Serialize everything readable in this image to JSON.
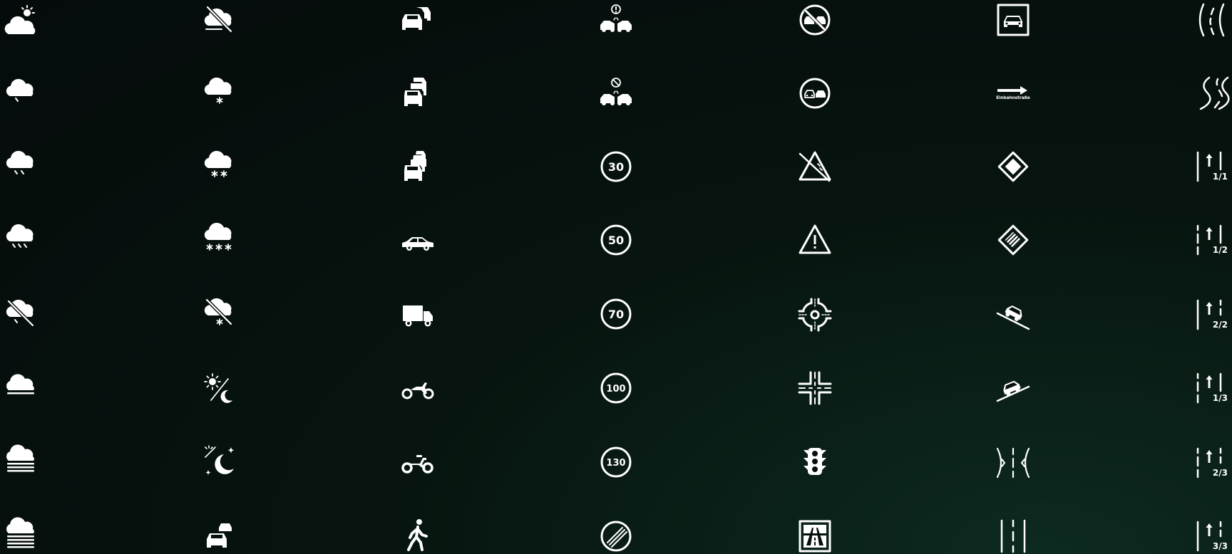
{
  "speed_limits": {
    "s30": "30",
    "s50": "50",
    "s70": "70",
    "s100": "100",
    "s130": "130"
  },
  "one_way_label": "Einbahnstraße",
  "lane_fractions": {
    "l11": "1/1",
    "l12": "1/2",
    "l22": "2/2",
    "l13": "1/3",
    "l23": "2/3",
    "l33": "3/3"
  },
  "colors": {
    "icon": "#ffffff",
    "background": "#050b0b",
    "background_glow": "#0d2a20"
  },
  "icons": [
    "partly-cloudy-icon",
    "drizzle-icon",
    "light-rain-icon",
    "rain-icon",
    "no-rain-icon",
    "fog-icon",
    "dense-fog-icon",
    "heavy-fog-icon",
    "no-cloud-icon",
    "light-snow-icon",
    "snow-icon",
    "heavy-snow-icon",
    "no-snow-icon",
    "sun-moon-icon",
    "clear-night-icon",
    "car-convoy-icon",
    "traffic-icon",
    "heavy-traffic-icon",
    "traffic-jam-icon",
    "car-icon",
    "truck-icon",
    "motorcycle-icon",
    "bicycle-icon",
    "pedestrian-icon",
    "accident-warning-icon",
    "accident-disabled-icon",
    "speed-limit-30-icon",
    "speed-limit-50-icon",
    "speed-limit-70-icon",
    "speed-limit-100-icon",
    "speed-limit-130-icon",
    "end-of-limits-icon",
    "no-overtaking-icon",
    "overtaking-icon",
    "slope-warning-icon",
    "danger-warning-icon",
    "roundabout-icon",
    "intersection-icon",
    "traffic-light-icon",
    "motorway-icon",
    "car-sign-icon",
    "one-way-icon",
    "priority-road-icon",
    "end-priority-road-icon",
    "downhill-icon",
    "uphill-icon",
    "road-narrows-icon",
    "lane-lines-icon",
    "road-curve-icon",
    "winding-road-icon",
    "lane-1-of-1-icon",
    "lane-1-of-2-icon",
    "lane-2-of-2-icon",
    "lane-1-of-3-icon",
    "lane-2-of-3-icon",
    "lane-3-of-3-icon"
  ]
}
